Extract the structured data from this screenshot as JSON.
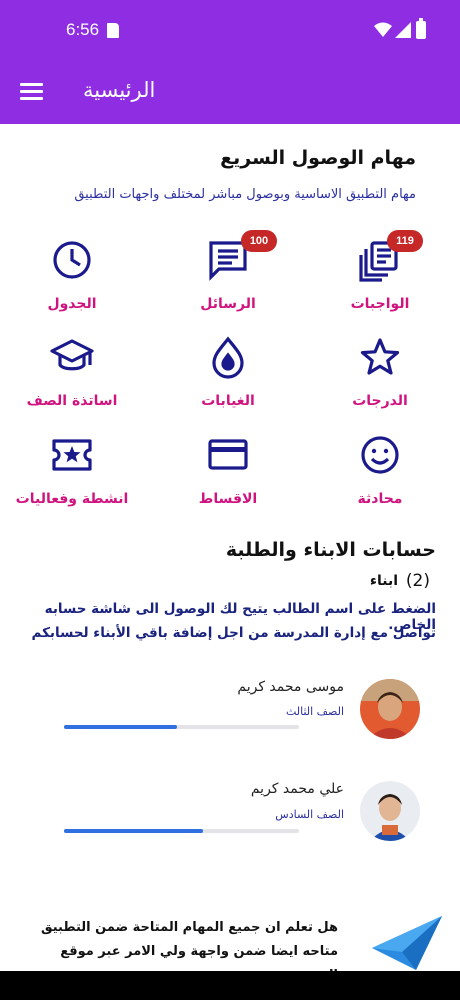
{
  "status": {
    "time": "6:56"
  },
  "appbar": {
    "title": "الرئيسية"
  },
  "quick": {
    "title": "مهام الوصول السريع",
    "subtitle": "مهام التطبيق الاساسية وبوصول مباشر لمختلف واجهات التطبيق",
    "items": [
      {
        "label": "الواجبات",
        "icon": "homework-icon",
        "badge": "119"
      },
      {
        "label": "الرسائل",
        "icon": "messages-icon",
        "badge": "100"
      },
      {
        "label": "الجدول",
        "icon": "schedule-clock-icon"
      },
      {
        "label": "الدرجات",
        "icon": "star-icon"
      },
      {
        "label": "الغيابات",
        "icon": "absence-drop-icon"
      },
      {
        "label": "اساتذة الصف",
        "icon": "graduation-cap-icon"
      },
      {
        "label": "محادثة",
        "icon": "smiley-icon"
      },
      {
        "label": "الاقساط",
        "icon": "credit-card-icon"
      },
      {
        "label": "انشطة وفعاليات",
        "icon": "ticket-star-icon"
      }
    ]
  },
  "kids": {
    "title": "حسابات الابناء والطلبة",
    "count_label": "ابناء",
    "count_value": "(2)",
    "info_line1": "الضغط على اسم الطالب يتيح لك الوصول الى شاشة حسابه الخاص.",
    "info_line2": "تواصل مع إدارة المدرسة من اجل إضافة باقي الأبناء لحسابكم",
    "students": [
      {
        "name": "موسى محمد كريم",
        "grade": "الصف الثالث",
        "progress": 0.48
      },
      {
        "name": "علي محمد كريم",
        "grade": "الصف السادس",
        "progress": 0.59
      }
    ]
  },
  "promo": {
    "line1": "هل تعلم ان جميع المهام المتاحة ضمن التطبيق",
    "line2": "متاحه ايضا ضمن واجهة  ولي الامر عبر موقع",
    "line3": "المدرسة"
  },
  "colors": {
    "primary": "#8e2de2",
    "icon": "#1a1a8c",
    "label": "#d0147f",
    "badge": "#c62828",
    "progress": "#2f6fe0"
  }
}
